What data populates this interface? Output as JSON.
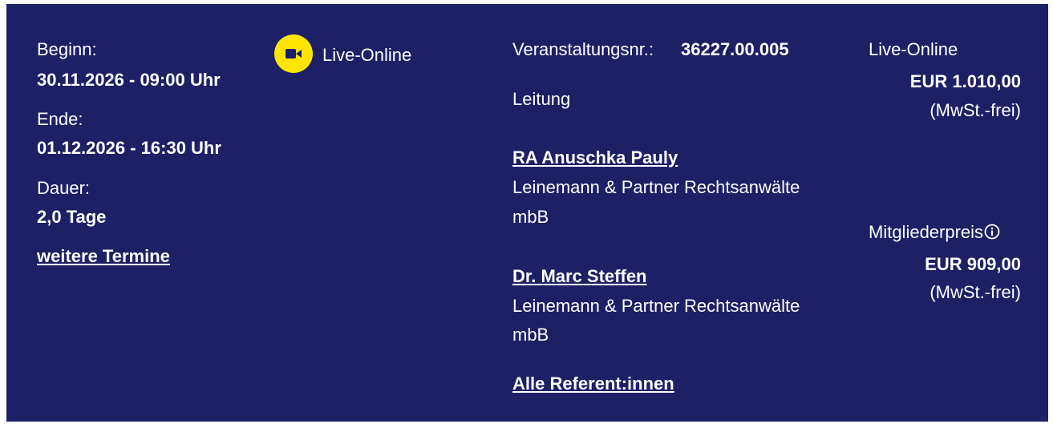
{
  "schedule": {
    "start_label": "Beginn:",
    "start_value": "30.11.2026 - 09:00 Uhr",
    "end_label": "Ende:",
    "end_value": "01.12.2026 - 16:30 Uhr",
    "duration_label": "Dauer:",
    "duration_value": "2,0 Tage",
    "more_dates_link": "weitere Termine"
  },
  "format": {
    "icon": "video-camera-icon",
    "label": "Live-Online",
    "icon_bg_color": "#ffe500"
  },
  "event": {
    "number_label": "Veranstaltungsnr.:",
    "number_value": "36227.00.005",
    "lead_label": "Leitung",
    "speakers": [
      {
        "name": "RA Anuschka Pauly",
        "org_line1": "Leinemann & Partner Rechtsanwälte",
        "org_line2": "mbB"
      },
      {
        "name": "Dr. Marc Steffen",
        "org_line1": "Leinemann & Partner Rechtsanwälte",
        "org_line2": "mbB"
      }
    ],
    "all_speakers_link": "Alle Referent:innen"
  },
  "pricing": {
    "regular_label": "Live-Online",
    "regular_price": "EUR 1.010,00",
    "regular_note": "(MwSt.-frei)",
    "member_label": "Mitgliederpreis",
    "member_info_icon": "info-icon",
    "member_price": "EUR 909,00",
    "member_note": "(MwSt.-frei)"
  },
  "colors": {
    "panel_bg": "#1e2066",
    "text": "#ffffff",
    "accent": "#ffe500"
  }
}
